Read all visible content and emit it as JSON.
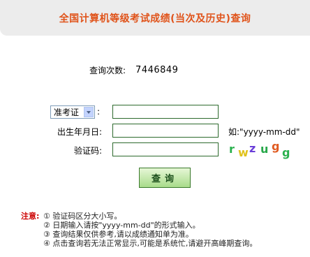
{
  "header": {
    "title": "全国计算机等级考试成绩(当次及历史)查询"
  },
  "stats": {
    "count_label": "查询次数:",
    "count_value": "7446849"
  },
  "form": {
    "id_type_selected": "准考证",
    "colon": ":",
    "birth_label": "出生年月日:",
    "birth_hint": "如:\"yyyy-mm-dd\"",
    "captcha_label": "验证码:",
    "captcha_chars": [
      "r",
      "w",
      "z",
      "u",
      "g",
      "g"
    ],
    "submit_label": "查询"
  },
  "notes": {
    "label": "注意:",
    "lines": [
      "① 验证码区分大小写。",
      "② 日期输入请按\"yyyy-mm-dd\"的形式输入。",
      "③ 查询结果仅供参考,请以成绩通知单为准。",
      "④ 点击查询若无法正常显示,可能是系统忙,请避开高峰期查询。"
    ]
  },
  "colors": {
    "title": "#e0531a",
    "header_bg": "#ececec",
    "note_label": "#cc0000",
    "button_border": "#3b7a2c"
  }
}
